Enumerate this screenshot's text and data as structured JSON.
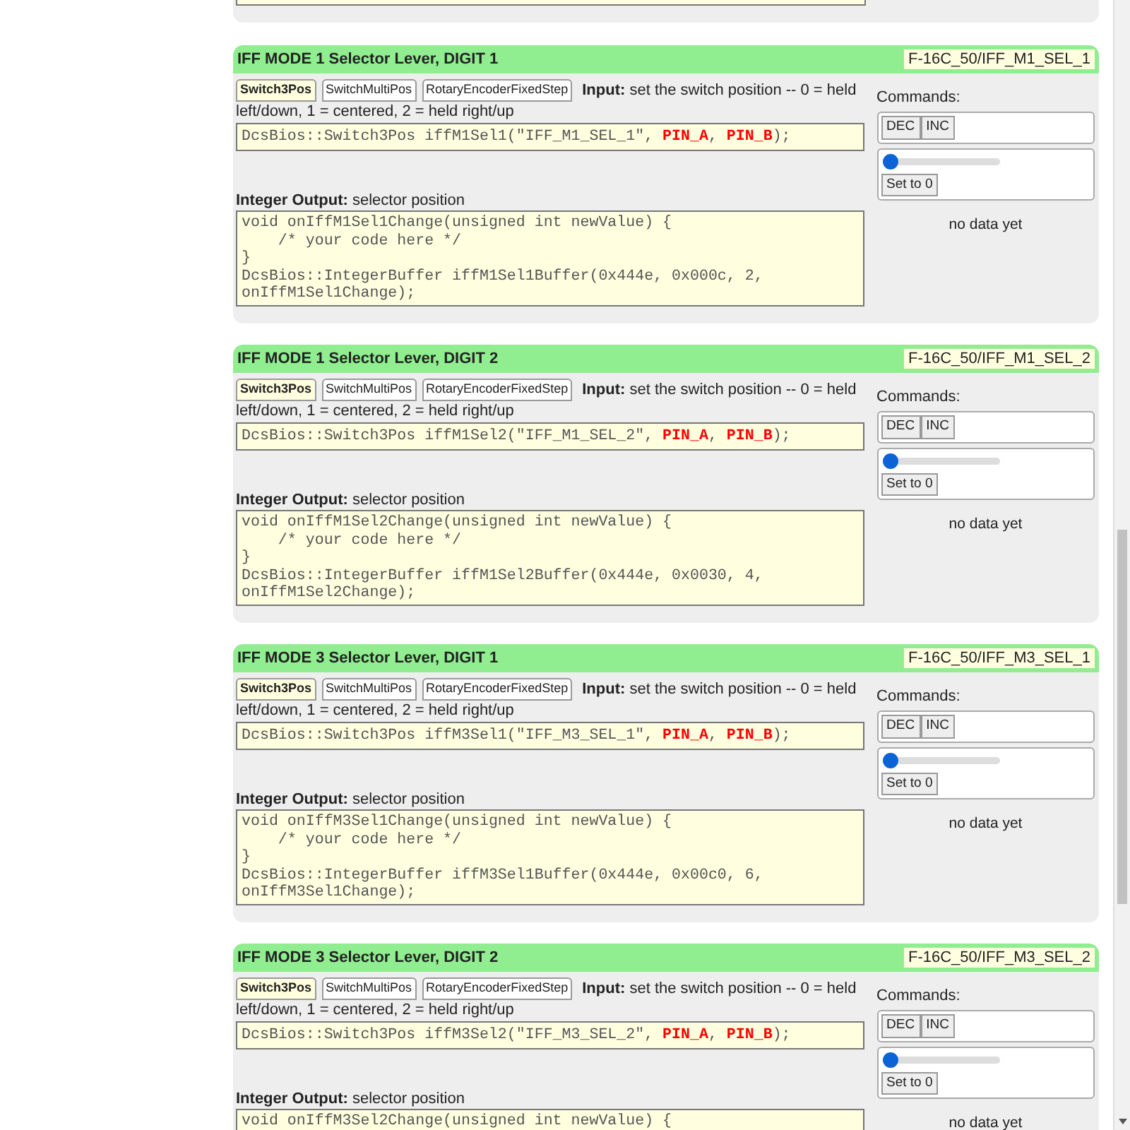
{
  "cards": [
    {
      "title": "IFF MODE 1 Selector Lever, DIGIT 1",
      "identifier": "F-16C_50/IFF_M1_SEL_1",
      "tabs": [
        {
          "label": "Switch3Pos",
          "selected": true
        },
        {
          "label": "SwitchMultiPos",
          "selected": false
        },
        {
          "label": "RotaryEncoderFixedStep",
          "selected": false
        }
      ],
      "input_label": "Input:",
      "input_text": [
        "set the switch position -- 0 = held",
        "left/down, 1 = centered, 2 = held right/up"
      ],
      "input_code": [
        {
          "kind": "plain",
          "text": "DcsBios::Switch3Pos iffM1Sel1(\"IFF_M1_SEL_1\", "
        },
        {
          "kind": "pin",
          "text": "PIN_A"
        },
        {
          "kind": "plain",
          "text": ", "
        },
        {
          "kind": "pin",
          "text": "PIN_B"
        },
        {
          "kind": "plain",
          "text": ");"
        }
      ],
      "output_label": "Integer Output:",
      "output_text": "selector position",
      "output_code": [
        "void onIffM1Sel1Change(unsigned int newValue) {",
        "    /* your code here */",
        "}",
        "DcsBios::IntegerBuffer iffM1Sel1Buffer(0x444e, 0x000c, 2,",
        "onIffM1Sel1Change);"
      ],
      "commands_label": "Commands:",
      "buttons": [
        "DEC",
        "INC"
      ],
      "slider": {
        "level": 0
      },
      "set_button": "Set to 0",
      "status": "no data yet"
    },
    {
      "title": "IFF MODE 1 Selector Lever, DIGIT 2",
      "identifier": "F-16C_50/IFF_M1_SEL_2",
      "tabs": [
        {
          "label": "Switch3Pos",
          "selected": true
        },
        {
          "label": "SwitchMultiPos",
          "selected": false
        },
        {
          "label": "RotaryEncoderFixedStep",
          "selected": false
        }
      ],
      "input_label": "Input:",
      "input_text": [
        "set the switch position -- 0 = held",
        "left/down, 1 = centered, 2 = held right/up"
      ],
      "input_code": [
        {
          "kind": "plain",
          "text": "DcsBios::Switch3Pos iffM1Sel2(\"IFF_M1_SEL_2\", "
        },
        {
          "kind": "pin",
          "text": "PIN_A"
        },
        {
          "kind": "plain",
          "text": ", "
        },
        {
          "kind": "pin",
          "text": "PIN_B"
        },
        {
          "kind": "plain",
          "text": ");"
        }
      ],
      "output_label": "Integer Output:",
      "output_text": "selector position",
      "output_code": [
        "void onIffM1Sel2Change(unsigned int newValue) {",
        "    /* your code here */",
        "}",
        "DcsBios::IntegerBuffer iffM1Sel2Buffer(0x444e, 0x0030, 4,",
        "onIffM1Sel2Change);"
      ],
      "commands_label": "Commands:",
      "buttons": [
        "DEC",
        "INC"
      ],
      "slider": {
        "level": 0
      },
      "set_button": "Set to 0",
      "status": "no data yet"
    },
    {
      "title": "IFF MODE 3 Selector Lever, DIGIT 1",
      "identifier": "F-16C_50/IFF_M3_SEL_1",
      "tabs": [
        {
          "label": "Switch3Pos",
          "selected": true
        },
        {
          "label": "SwitchMultiPos",
          "selected": false
        },
        {
          "label": "RotaryEncoderFixedStep",
          "selected": false
        }
      ],
      "input_label": "Input:",
      "input_text": [
        "set the switch position -- 0 = held",
        "left/down, 1 = centered, 2 = held right/up"
      ],
      "input_code": [
        {
          "kind": "plain",
          "text": "DcsBios::Switch3Pos iffM3Sel1(\"IFF_M3_SEL_1\", "
        },
        {
          "kind": "pin",
          "text": "PIN_A"
        },
        {
          "kind": "plain",
          "text": ", "
        },
        {
          "kind": "pin",
          "text": "PIN_B"
        },
        {
          "kind": "plain",
          "text": ");"
        }
      ],
      "output_label": "Integer Output:",
      "output_text": "selector position",
      "output_code": [
        "void onIffM3Sel1Change(unsigned int newValue) {",
        "    /* your code here */",
        "}",
        "DcsBios::IntegerBuffer iffM3Sel1Buffer(0x444e, 0x00c0, 6,",
        "onIffM3Sel1Change);"
      ],
      "commands_label": "Commands:",
      "buttons": [
        "DEC",
        "INC"
      ],
      "slider": {
        "level": 0
      },
      "set_button": "Set to 0",
      "status": "no data yet"
    },
    {
      "title": "IFF MODE 3 Selector Lever, DIGIT 2",
      "identifier": "F-16C_50/IFF_M3_SEL_2",
      "tabs": [
        {
          "label": "Switch3Pos",
          "selected": true
        },
        {
          "label": "SwitchMultiPos",
          "selected": false
        },
        {
          "label": "RotaryEncoderFixedStep",
          "selected": false
        }
      ],
      "input_label": "Input:",
      "input_text": [
        "set the switch position -- 0 = held",
        "left/down, 1 = centered, 2 = held right/up"
      ],
      "input_code": [
        {
          "kind": "plain",
          "text": "DcsBios::Switch3Pos iffM3Sel2(\"IFF_M3_SEL_2\", "
        },
        {
          "kind": "pin",
          "text": "PIN_A"
        },
        {
          "kind": "plain",
          "text": ", "
        },
        {
          "kind": "pin",
          "text": "PIN_B"
        },
        {
          "kind": "plain",
          "text": ");"
        }
      ],
      "output_label": "Integer Output:",
      "output_text": "selector position",
      "output_code": [
        "void onIffM3Sel2Change(unsigned int newValue) {"
      ],
      "commands_label": "Commands:",
      "buttons": [
        "DEC",
        "INC"
      ],
      "slider": {
        "level": 0
      },
      "set_button": "Set to 0",
      "status": "no data yet"
    }
  ]
}
